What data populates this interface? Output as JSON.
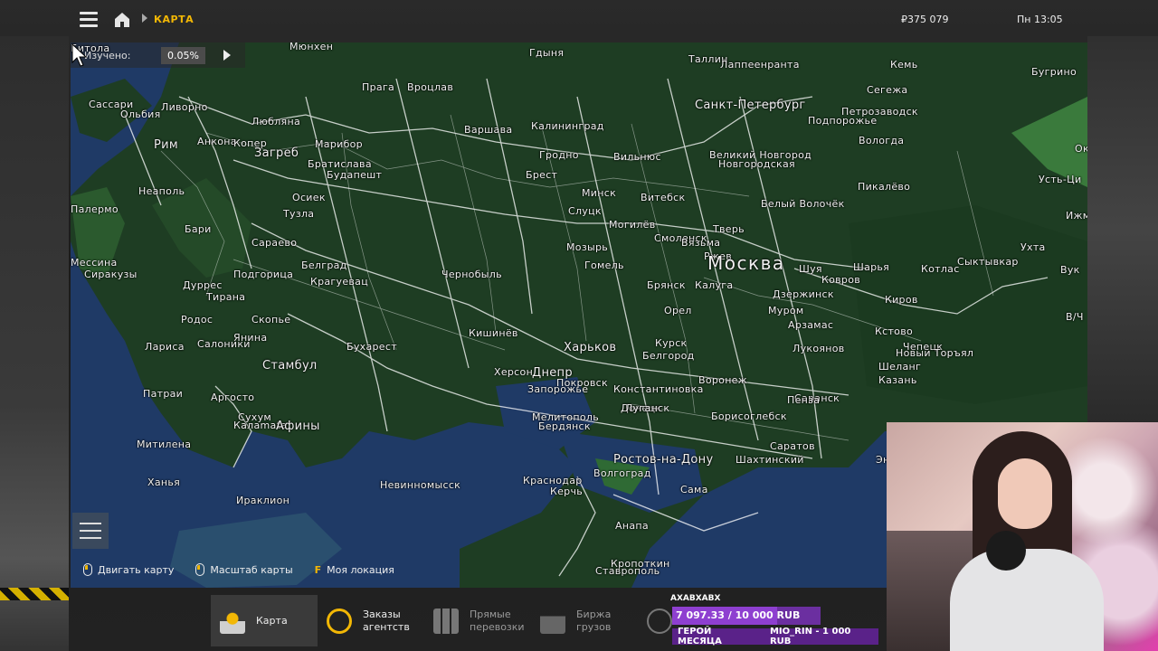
{
  "topbar": {
    "breadcrumb": "КАРТА",
    "money": "₽375 079",
    "clock": "Пн 13:05"
  },
  "map": {
    "studied_label": "Изучено:",
    "studied_value": "0.05%",
    "cities": [
      {
        "name": "Мюнхен",
        "size": "sm"
      },
      {
        "name": "Прага",
        "size": "sm"
      },
      {
        "name": "Вроцлав",
        "size": "sm"
      },
      {
        "name": "Гдыня",
        "size": "sm"
      },
      {
        "name": "Таллин",
        "size": "sm"
      },
      {
        "name": "Лаппеенранта",
        "size": "sm"
      },
      {
        "name": "Кемь",
        "size": "sm"
      },
      {
        "name": "Бугрино",
        "size": "sm"
      },
      {
        "name": "Санкт-Петербург",
        "size": "med"
      },
      {
        "name": "Петрозаводск",
        "size": "sm"
      },
      {
        "name": "Сегежа",
        "size": "sm"
      },
      {
        "name": "Подпорожье",
        "size": "sm"
      },
      {
        "name": "Ливорно",
        "size": "sm"
      },
      {
        "name": "Сассари",
        "size": "sm"
      },
      {
        "name": "Ольбия",
        "size": "sm"
      },
      {
        "name": "Рим",
        "size": "med"
      },
      {
        "name": "Анкона",
        "size": "sm"
      },
      {
        "name": "Копер",
        "size": "sm"
      },
      {
        "name": "Любляна",
        "size": "sm"
      },
      {
        "name": "Загреб",
        "size": "med"
      },
      {
        "name": "Марибор",
        "size": "sm"
      },
      {
        "name": "Братислава",
        "size": "sm"
      },
      {
        "name": "Варшава",
        "size": "sm"
      },
      {
        "name": "Калининград",
        "size": "sm"
      },
      {
        "name": "Вильнюс",
        "size": "sm"
      },
      {
        "name": "Гродно",
        "size": "sm"
      },
      {
        "name": "Брест",
        "size": "sm"
      },
      {
        "name": "Минск",
        "size": "sm"
      },
      {
        "name": "Витебск",
        "size": "sm"
      },
      {
        "name": "Великий Новгород",
        "size": "sm"
      },
      {
        "name": "Новгородская",
        "size": "sm"
      },
      {
        "name": "Вологда",
        "size": "sm"
      },
      {
        "name": "Пикалёво",
        "size": "sm"
      },
      {
        "name": "Белый Волочёк",
        "size": "sm"
      },
      {
        "name": "Неаполь",
        "size": "sm"
      },
      {
        "name": "Палермо",
        "size": "sm"
      },
      {
        "name": "Будапешт",
        "size": "sm"
      },
      {
        "name": "Осиек",
        "size": "sm"
      },
      {
        "name": "Тузла",
        "size": "sm"
      },
      {
        "name": "Сараево",
        "size": "sm"
      },
      {
        "name": "Белград",
        "size": "sm"
      },
      {
        "name": "Крагуевац",
        "size": "sm"
      },
      {
        "name": "Подгорица",
        "size": "sm"
      },
      {
        "name": "Дуррес",
        "size": "sm"
      },
      {
        "name": "Тирана",
        "size": "sm"
      },
      {
        "name": "Скопье",
        "size": "sm"
      },
      {
        "name": "Бари",
        "size": "sm"
      },
      {
        "name": "Мессина",
        "size": "sm"
      },
      {
        "name": "Сиракузы",
        "size": "sm"
      },
      {
        "name": "Слуцк",
        "size": "sm"
      },
      {
        "name": "Могилёв",
        "size": "sm"
      },
      {
        "name": "Смоленск",
        "size": "sm"
      },
      {
        "name": "Тверь",
        "size": "sm"
      },
      {
        "name": "Ржев",
        "size": "sm"
      },
      {
        "name": "Вязьма",
        "size": "sm"
      },
      {
        "name": "Москва",
        "size": "big"
      },
      {
        "name": "Шуя",
        "size": "sm"
      },
      {
        "name": "Шарья",
        "size": "sm"
      },
      {
        "name": "Котлас",
        "size": "sm"
      },
      {
        "name": "Сыктывкар",
        "size": "sm"
      },
      {
        "name": "Ухта",
        "size": "sm"
      },
      {
        "name": "Ижма",
        "size": "sm"
      },
      {
        "name": "Усть-Ци",
        "size": "sm"
      },
      {
        "name": "Оку",
        "size": "sm"
      },
      {
        "name": "Вук",
        "size": "sm"
      },
      {
        "name": "В/Ч",
        "size": "sm"
      },
      {
        "name": "Мозырь",
        "size": "sm"
      },
      {
        "name": "Гомель",
        "size": "sm"
      },
      {
        "name": "Брянск",
        "size": "sm"
      },
      {
        "name": "Калуга",
        "size": "sm"
      },
      {
        "name": "Ковров",
        "size": "sm"
      },
      {
        "name": "Дзержинск",
        "size": "sm"
      },
      {
        "name": "Киров",
        "size": "sm"
      },
      {
        "name": "Орел",
        "size": "sm"
      },
      {
        "name": "Муром",
        "size": "sm"
      },
      {
        "name": "Арзамас",
        "size": "sm"
      },
      {
        "name": "Кстово",
        "size": "sm"
      },
      {
        "name": "Чепецк",
        "size": "sm"
      },
      {
        "name": "Новый Торъял",
        "size": "sm"
      },
      {
        "name": "Лукоянов",
        "size": "sm"
      },
      {
        "name": "Шеланг",
        "size": "sm"
      },
      {
        "name": "Казань",
        "size": "sm"
      },
      {
        "name": "Чернобыль",
        "size": "sm"
      },
      {
        "name": "Кишинёв",
        "size": "sm"
      },
      {
        "name": "Бухарест",
        "size": "sm"
      },
      {
        "name": "Харьков",
        "size": "med"
      },
      {
        "name": "Белгород",
        "size": "sm"
      },
      {
        "name": "Курск",
        "size": "sm"
      },
      {
        "name": "Воронеж",
        "size": "sm"
      },
      {
        "name": "Саранск",
        "size": "sm"
      },
      {
        "name": "Пенза",
        "size": "sm"
      },
      {
        "name": "Херсон",
        "size": "sm"
      },
      {
        "name": "Днепр",
        "size": "med"
      },
      {
        "name": "Запорожье",
        "size": "sm"
      },
      {
        "name": "Покровск",
        "size": "sm"
      },
      {
        "name": "Константиновка",
        "size": "sm"
      },
      {
        "name": "Донецк",
        "size": "sm"
      },
      {
        "name": "Луганск",
        "size": "sm"
      },
      {
        "name": "Мелитополь",
        "size": "sm"
      },
      {
        "name": "Бердянск",
        "size": "sm"
      },
      {
        "name": "Борисоглебск",
        "size": "sm"
      },
      {
        "name": "Саратов",
        "size": "sm"
      },
      {
        "name": "Ростов-на-Дону",
        "size": "med"
      },
      {
        "name": "Шахтинский",
        "size": "sm"
      },
      {
        "name": "Энгельс",
        "size": "sm"
      },
      {
        "name": "Сама",
        "size": "sm"
      },
      {
        "name": "Волгоград",
        "size": "sm"
      },
      {
        "name": "Керчь",
        "size": "sm"
      },
      {
        "name": "Краснодар",
        "size": "sm"
      },
      {
        "name": "Анапа",
        "size": "sm"
      },
      {
        "name": "Кропоткин",
        "size": "sm"
      },
      {
        "name": "Ставрополь",
        "size": "sm"
      },
      {
        "name": "Невинномысск",
        "size": "sm"
      },
      {
        "name": "Сухум",
        "size": "sm"
      },
      {
        "name": "Стамбул",
        "size": "med"
      },
      {
        "name": "Салоники",
        "size": "sm"
      },
      {
        "name": "Лариса",
        "size": "sm"
      },
      {
        "name": "Патраи",
        "size": "sm"
      },
      {
        "name": "Аргосто",
        "size": "sm"
      },
      {
        "name": "Калаmata",
        "size": "sm"
      },
      {
        "name": "Афины",
        "size": "med"
      },
      {
        "name": "Митилена",
        "size": "sm"
      },
      {
        "name": "Ханья",
        "size": "sm"
      },
      {
        "name": "Ираклион",
        "size": "sm"
      },
      {
        "name": "Родос",
        "size": "sm"
      },
      {
        "name": "Янина",
        "size": "sm"
      },
      {
        "name": "Битола",
        "size": "sm"
      }
    ],
    "hints": [
      {
        "key": "",
        "label": "Двигать карту"
      },
      {
        "key": "",
        "label": "Масштаб карты"
      },
      {
        "key": "F",
        "label": "Моя локация"
      }
    ]
  },
  "bottom_nav": [
    {
      "label": "Карта",
      "label2": "",
      "icon": "map-icon",
      "active": true
    },
    {
      "label": "Заказы",
      "label2": "агентств",
      "icon": "clock-icon",
      "active": false
    },
    {
      "label": "Прямые",
      "label2": "перевозки",
      "icon": "grid-icon",
      "active": false
    },
    {
      "label": "Биржа",
      "label2": "грузов",
      "icon": "truck-icon",
      "active": false
    },
    {
      "label": "",
      "label2": "",
      "icon": "globe-icon",
      "active": false
    }
  ],
  "stream_overlay": {
    "username": "AXABXABX",
    "goal_text": "7 097.33 / 10 000 RUB",
    "goal_fraction": 0.71,
    "hero_title": "ГЕРОЙ МЕСЯЦА",
    "hero_value": "MIO_RIN - 1 000 RUB"
  },
  "colors": {
    "accent": "#f2b705",
    "sea": "#1f3a66",
    "land": "#1d3b22",
    "roads": "#ffffff",
    "overlay_purple": "#8e3fd0"
  }
}
